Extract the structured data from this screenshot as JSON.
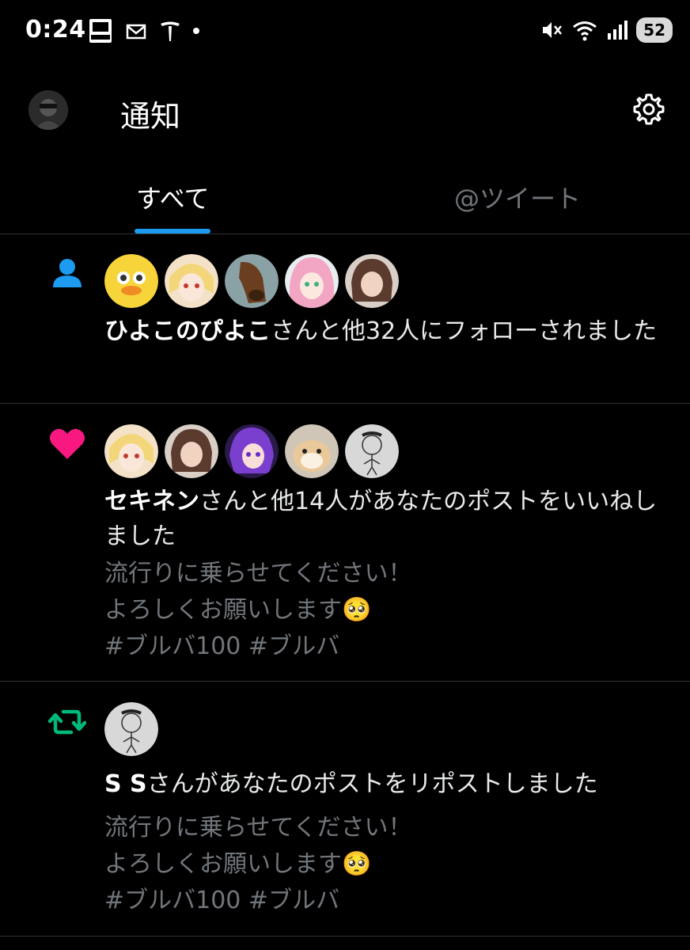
{
  "status_bar": {
    "time": "0:24",
    "battery": "52",
    "icons": [
      "panasonic-icon",
      "mail-icon",
      "tesla-icon",
      "notification-dot",
      "mute-icon",
      "wifi-icon",
      "signal-icon",
      "battery-icon"
    ]
  },
  "header": {
    "title": "通知",
    "settings_icon": "gear-icon"
  },
  "tabs": [
    {
      "label": "すべて",
      "selected": true
    },
    {
      "label": "@ツイート",
      "selected": false
    }
  ],
  "colors": {
    "accent": "#1d9bf0",
    "like": "#f91880",
    "repost": "#00ba7c",
    "muted_text": "#71767b",
    "background": "#000000"
  },
  "notifications": [
    {
      "type": "follow",
      "icon": "person-icon",
      "actor": "ひよこのぴよこ",
      "message": "さんと他32人にフォローされました",
      "avatars": [
        "duck-avatar",
        "blonde-girl-avatar",
        "horse-avatar",
        "pink-hair-girl-avatar",
        "brown-hair-girl-avatar"
      ]
    },
    {
      "type": "like",
      "icon": "heart-icon",
      "actor": "セキネン",
      "message": "さんと他14人があなたのポストをいいねしました",
      "avatars": [
        "blonde-girl-avatar",
        "brown-hair-girl-avatar",
        "purple-hair-girl-avatar",
        "hamster-avatar",
        "sketch-person-avatar"
      ],
      "post_text": "流行りに乗らせてください！\nよろしくお願いします🥺\n#ブルバ100 #ブルバ"
    },
    {
      "type": "repost",
      "icon": "repost-icon",
      "actor": "S S",
      "message": "さんがあなたのポストをリポストしました",
      "avatars": [
        "sketch-person-avatar"
      ],
      "post_text": "流行りに乗らせてください！\nよろしくお願いします🥺\n#ブルバ100 #ブルバ"
    }
  ]
}
